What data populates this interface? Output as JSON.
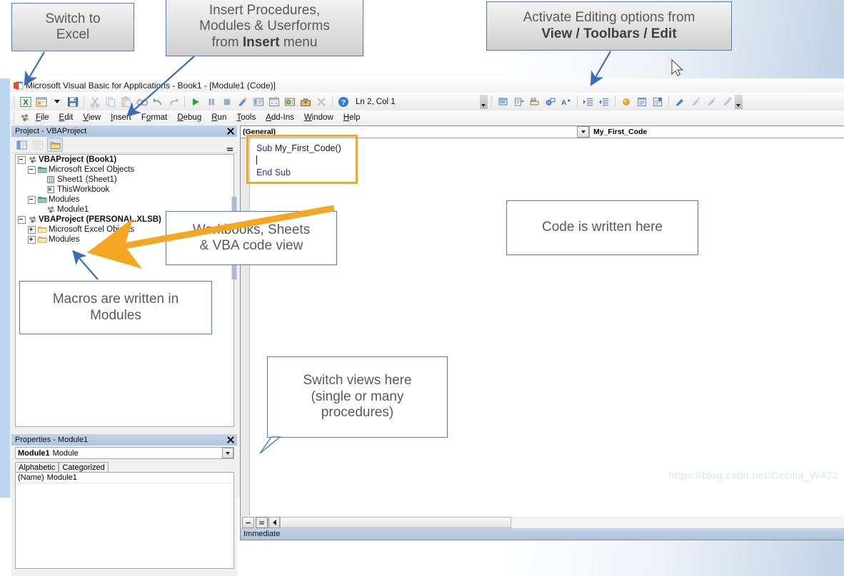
{
  "app": {
    "title": "Microsoft Visual Basic for Applications - Book1 - [Module1 (Code)]",
    "logo_icon": "vba-excel-logo-icon"
  },
  "toolbar": {
    "position_label": "Ln 2, Col 1",
    "buttons": [
      {
        "name": "view-excel-button",
        "icon": "excel-icon"
      },
      {
        "name": "insert-userform-button",
        "icon": "userform-icon"
      },
      {
        "name": "insert-dropdown-button",
        "icon": "chevron-down-icon"
      },
      {
        "name": "save-button",
        "icon": "floppy-disk-icon"
      },
      {
        "name": "cut-button",
        "icon": "scissors-icon"
      },
      {
        "name": "copy-button",
        "icon": "copy-icon"
      },
      {
        "name": "paste-button",
        "icon": "clipboard-icon"
      },
      {
        "name": "find-button",
        "icon": "binoculars-icon"
      },
      {
        "name": "undo-button",
        "icon": "undo-arrow-icon"
      },
      {
        "name": "redo-button",
        "icon": "redo-arrow-icon"
      },
      {
        "name": "run-button",
        "icon": "play-triangle-icon"
      },
      {
        "name": "break-button",
        "icon": "pause-icon"
      },
      {
        "name": "reset-button",
        "icon": "stop-square-icon"
      },
      {
        "name": "design-mode-button",
        "icon": "design-mode-icon"
      },
      {
        "name": "project-explorer-button",
        "icon": "project-explorer-icon"
      },
      {
        "name": "properties-window-button",
        "icon": "properties-window-icon"
      },
      {
        "name": "object-browser-button",
        "icon": "object-browser-icon"
      },
      {
        "name": "toolbox-button",
        "icon": "toolbox-icon"
      },
      {
        "name": "help-button",
        "icon": "help-question-icon"
      }
    ],
    "edit_buttons": [
      {
        "name": "list-properties-methods-button",
        "icon": "list-properties-icon"
      },
      {
        "name": "list-constants-button",
        "icon": "list-constants-icon"
      },
      {
        "name": "quick-info-button",
        "icon": "quick-info-icon"
      },
      {
        "name": "parameter-info-button",
        "icon": "parameter-info-icon"
      },
      {
        "name": "complete-word-button",
        "icon": "complete-word-icon"
      },
      {
        "name": "indent-button",
        "icon": "indent-icon"
      },
      {
        "name": "outdent-button",
        "icon": "outdent-icon"
      },
      {
        "name": "toggle-breakpoint-button",
        "icon": "toggle-breakpoint-icon"
      },
      {
        "name": "comment-block-button",
        "icon": "comment-block-icon"
      },
      {
        "name": "uncomment-block-button",
        "icon": "uncomment-block-icon"
      },
      {
        "name": "toggle-bookmark-button",
        "icon": "bookmark-icon"
      },
      {
        "name": "next-bookmark-button",
        "icon": "next-bookmark-icon"
      },
      {
        "name": "previous-bookmark-button",
        "icon": "previous-bookmark-icon"
      },
      {
        "name": "clear-bookmarks-button",
        "icon": "clear-bookmarks-icon"
      }
    ]
  },
  "menu": {
    "items": [
      {
        "label": "File",
        "accel": "F"
      },
      {
        "label": "Edit",
        "accel": "E"
      },
      {
        "label": "View",
        "accel": "V"
      },
      {
        "label": "Insert",
        "accel": "I"
      },
      {
        "label": "Format",
        "accel": "o"
      },
      {
        "label": "Debug",
        "accel": "D"
      },
      {
        "label": "Run",
        "accel": "R"
      },
      {
        "label": "Tools",
        "accel": "T"
      },
      {
        "label": "Add-Ins",
        "accel": "A"
      },
      {
        "label": "Window",
        "accel": "W"
      },
      {
        "label": "Help",
        "accel": "H"
      }
    ]
  },
  "project_explorer": {
    "title": "Project - VBAProject",
    "close_label": "",
    "tools": [
      {
        "name": "view-code-button",
        "icon": "view-code-icon"
      },
      {
        "name": "view-object-button",
        "icon": "view-object-icon"
      },
      {
        "name": "toggle-folders-button",
        "icon": "folder-icon"
      }
    ],
    "tree": [
      {
        "label": "VBAProject (Book1)",
        "depth": 0,
        "icon": "vba-project-icon",
        "bold": true,
        "expander": "minus"
      },
      {
        "label": "Microsoft Excel Objects",
        "depth": 1,
        "icon": "folder-open-icon",
        "bold": false,
        "expander": "minus"
      },
      {
        "label": "Sheet1 (Sheet1)",
        "depth": 2,
        "icon": "worksheet-icon",
        "bold": false,
        "expander": "none"
      },
      {
        "label": "ThisWorkbook",
        "depth": 2,
        "icon": "workbook-icon",
        "bold": false,
        "expander": "none"
      },
      {
        "label": "Modules",
        "depth": 1,
        "icon": "folder-open-icon",
        "bold": false,
        "expander": "minus"
      },
      {
        "label": "Module1",
        "depth": 2,
        "icon": "module-icon",
        "bold": false,
        "expander": "none"
      },
      {
        "label": "VBAProject (PERSONAL.XLSB)",
        "depth": 0,
        "icon": "vba-project-icon",
        "bold": true,
        "expander": "minus"
      },
      {
        "label": "Microsoft Excel Objects",
        "depth": 1,
        "icon": "folder-closed-icon",
        "bold": false,
        "expander": "plus"
      },
      {
        "label": "Modules",
        "depth": 1,
        "icon": "folder-closed-icon",
        "bold": false,
        "expander": "plus"
      }
    ]
  },
  "properties": {
    "title": "Properties - Module1",
    "object_name": "Module1",
    "object_type": "Module",
    "tabs": [
      {
        "label": "Alphabetic",
        "selected": true
      },
      {
        "label": "Categorized",
        "selected": false
      }
    ],
    "rows": [
      {
        "name": "(Name)",
        "value": "Module1"
      }
    ]
  },
  "code_window": {
    "object_dropdown": "(General)",
    "procedure_dropdown": "My_First_Code",
    "code_lines": [
      {
        "keyword": "Sub",
        "rest": " My_First_Code()"
      },
      {
        "keyword": "",
        "rest": ""
      },
      {
        "keyword": "End Sub",
        "rest": ""
      }
    ],
    "view_buttons": [
      {
        "name": "procedure-view-button",
        "icon": "procedure-view-icon",
        "active": false
      },
      {
        "name": "full-module-view-button",
        "icon": "full-module-view-icon",
        "active": true
      }
    ],
    "immediate_title": "Immediate"
  },
  "callouts": [
    {
      "id": "switch-to-excel",
      "text": "Switch to\nExcel",
      "style": "grad"
    },
    {
      "id": "insert-procedures",
      "text": "Insert Procedures,\nModules & Userforms\nfrom ",
      "bold": "Insert",
      "tail": " menu",
      "style": "grad"
    },
    {
      "id": "activate-editing",
      "text": "Activate Editing options from\n",
      "bold": "View / Toolbars / Edit",
      "style": "grad"
    },
    {
      "id": "workbooks-sheets",
      "text": "Workbooks, Sheets\n& VBA code view",
      "style": "plain"
    },
    {
      "id": "code-written-here",
      "text": "Code is written here",
      "style": "plain"
    },
    {
      "id": "macros-in-modules",
      "text": "Macros are written in\nModules",
      "style": "plain"
    },
    {
      "id": "switch-views-here",
      "text": "Switch views here\n(single or many\nprocedures)",
      "style": "plain"
    }
  ],
  "watermark": "https://blog.csdn.net/Cecilia_W422",
  "colors": {
    "callout_border": "#4a7ebb",
    "arrow_blue": "#3a6cb5",
    "arrow_orange": "#f5a623",
    "panel_header": "#aec4dd",
    "code_keyword": "#333399"
  }
}
